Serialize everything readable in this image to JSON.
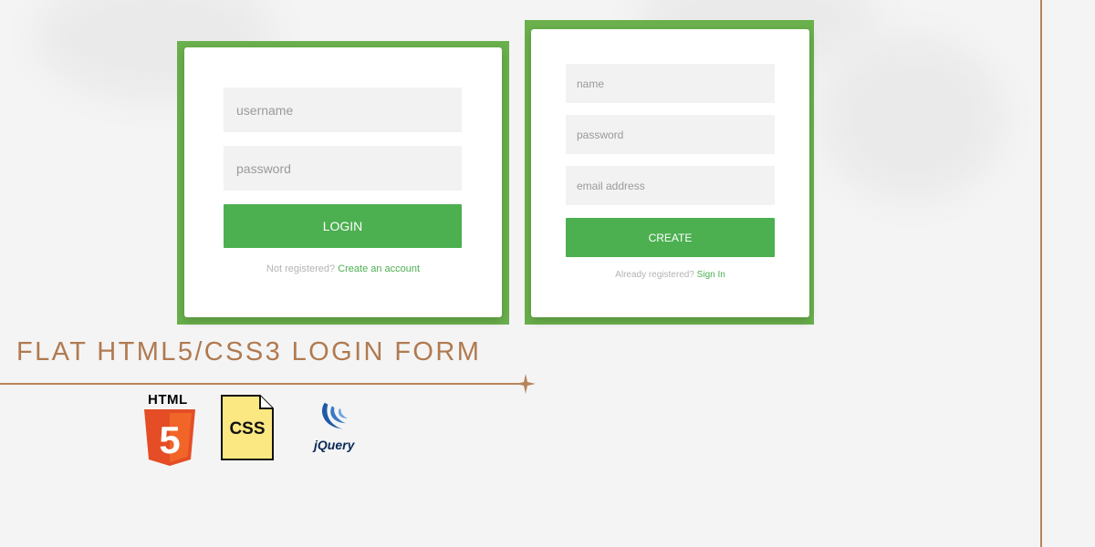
{
  "login_form": {
    "username_placeholder": "username",
    "password_placeholder": "password",
    "login_label": "LOGIN",
    "message_text": "Not registered?",
    "message_link": "Create an account"
  },
  "register_form": {
    "name_placeholder": "name",
    "password_placeholder": "password",
    "email_placeholder": "email address",
    "create_label": "CREATE",
    "message_text": "Already registered?",
    "message_link": "Sign In"
  },
  "banner": {
    "title": "FLAT HTML5/CSS3 LOGIN FORM"
  },
  "logos": {
    "html5_label": "HTML",
    "html5_digit": "5",
    "css_label": "CSS",
    "jquery_label": "jQuery"
  },
  "colors": {
    "accent_green": "#4caf50",
    "frame_green": "#6ab04c",
    "title_brown": "#b07a50"
  }
}
